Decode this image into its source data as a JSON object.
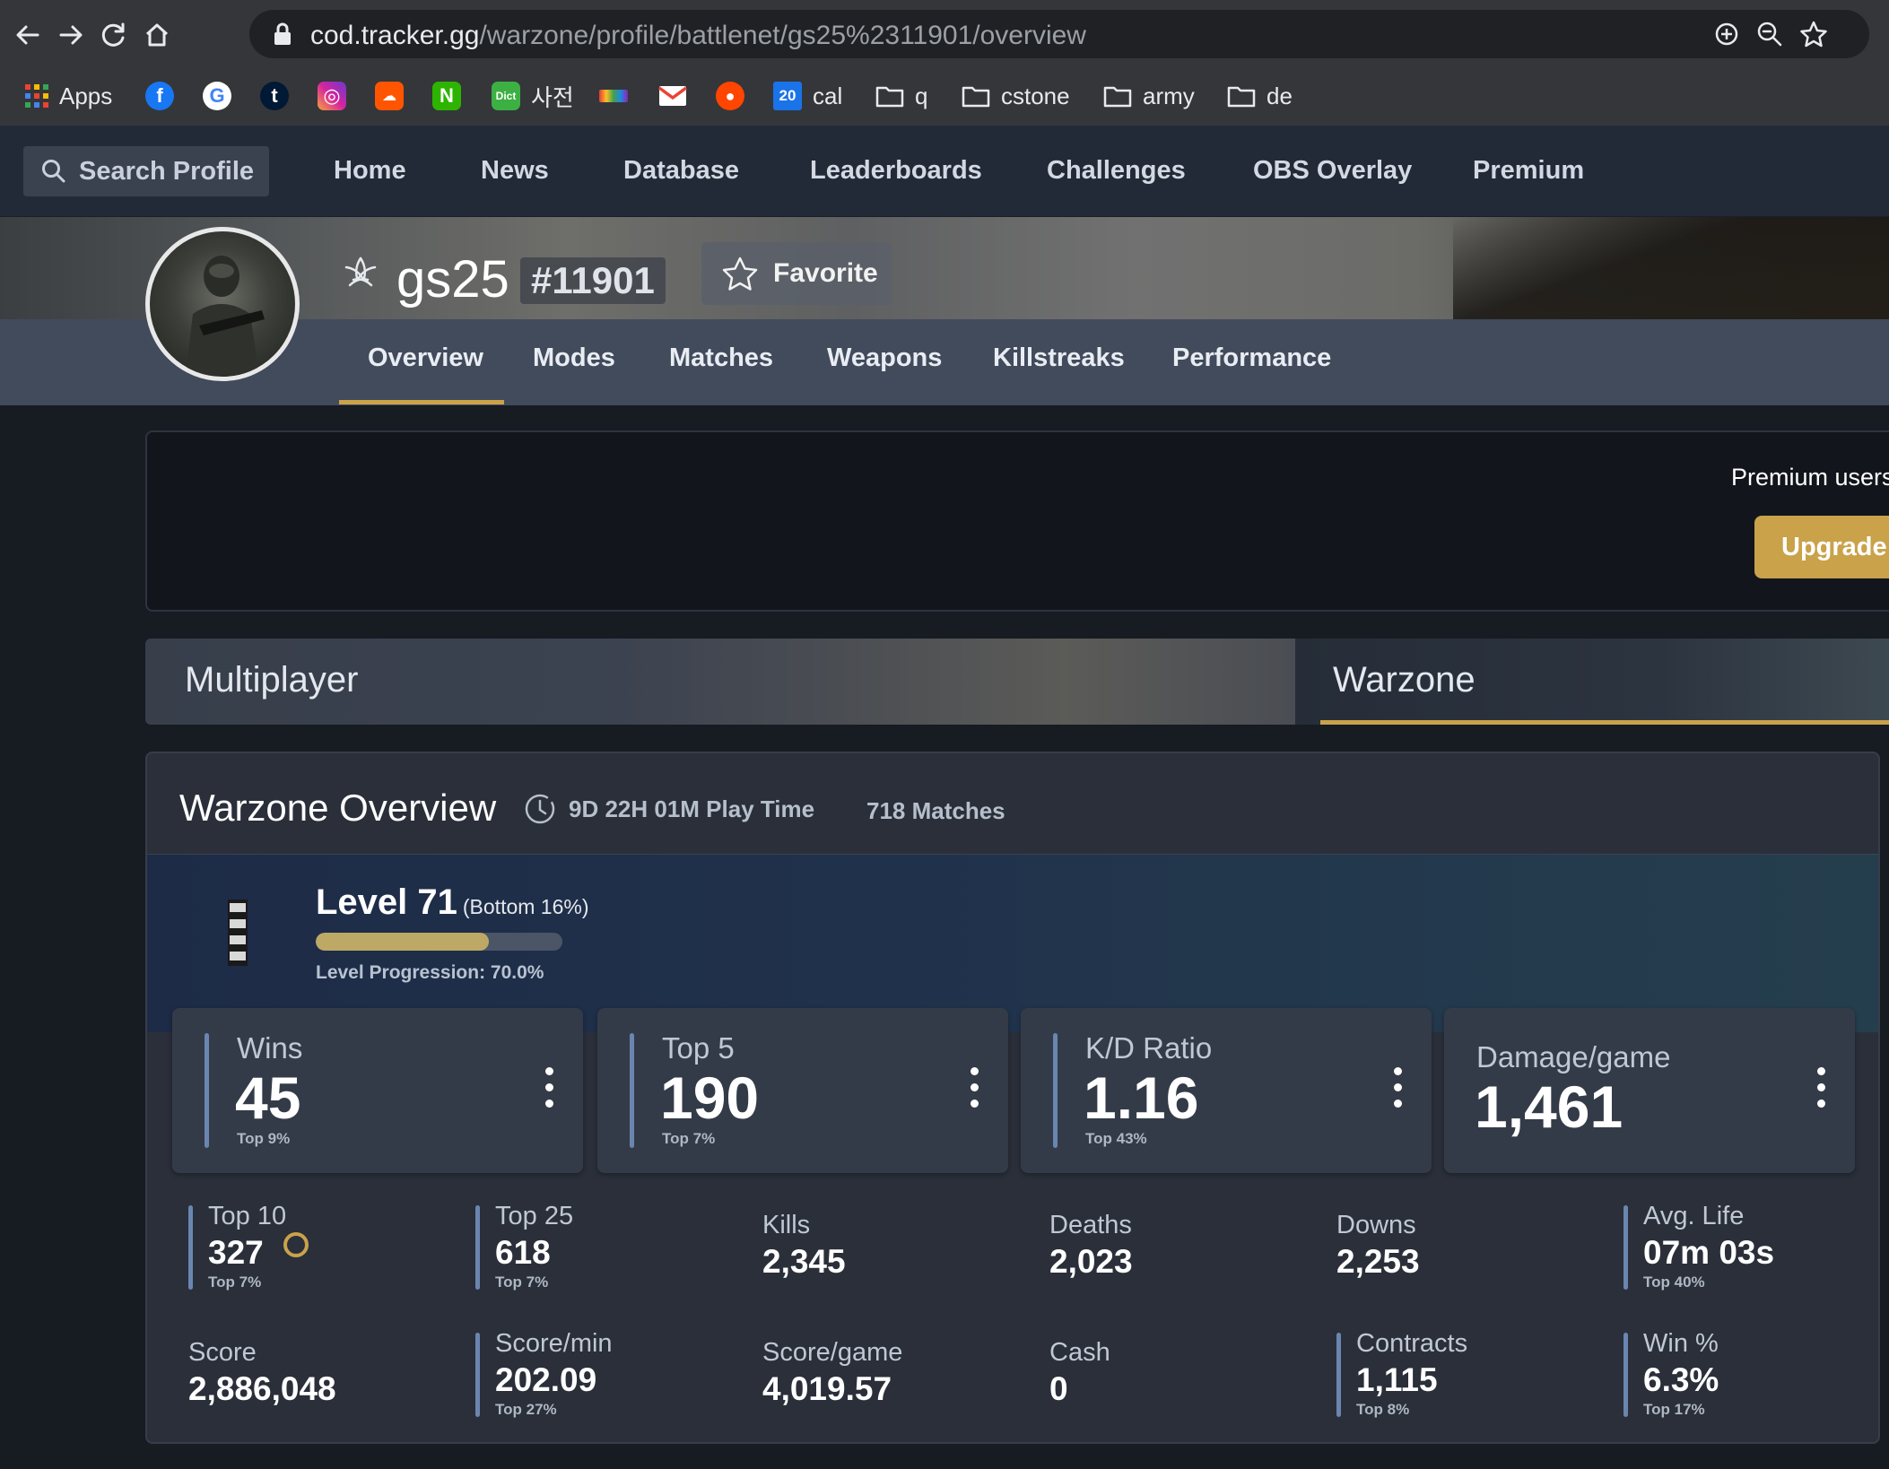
{
  "browser": {
    "url_host": "cod.tracker.gg",
    "url_path": "/warzone/profile/battlenet/gs25%2311901/overview",
    "bookmarks": [
      {
        "label": "Apps",
        "icon": "apps-grid-icon"
      },
      {
        "label": "",
        "icon": "facebook-icon"
      },
      {
        "label": "",
        "icon": "google-icon"
      },
      {
        "label": "",
        "icon": "tumblr-icon"
      },
      {
        "label": "",
        "icon": "instagram-icon"
      },
      {
        "label": "",
        "icon": "soundcloud-icon"
      },
      {
        "label": "",
        "icon": "naver-icon"
      },
      {
        "label": "사전",
        "icon": "dict-icon"
      },
      {
        "label": "",
        "icon": "colorbar-icon"
      },
      {
        "label": "",
        "icon": "gmail-icon"
      },
      {
        "label": "",
        "icon": "reddit-icon"
      },
      {
        "label": "cal",
        "icon": "calendar-icon",
        "icon_text": "20"
      },
      {
        "label": "q",
        "icon": "folder-icon"
      },
      {
        "label": "cstone",
        "icon": "folder-icon"
      },
      {
        "label": "army",
        "icon": "folder-icon"
      },
      {
        "label": "de",
        "icon": "folder-icon"
      }
    ]
  },
  "site_nav": {
    "search_label": "Search Profile",
    "links": [
      "Home",
      "News",
      "Database",
      "Leaderboards",
      "Challenges",
      "OBS Overlay",
      "Premium"
    ]
  },
  "profile": {
    "name": "gs25",
    "tag": "#11901",
    "favorite_label": "Favorite",
    "tabs": [
      "Overview",
      "Modes",
      "Matches",
      "Weapons",
      "Killstreaks",
      "Performance"
    ],
    "active_tab": "Overview"
  },
  "premium": {
    "text": "Premium users",
    "button_label": "Upgrade t"
  },
  "modes": {
    "items": [
      "Multiplayer",
      "Warzone"
    ],
    "active": "Warzone"
  },
  "overview": {
    "title": "Warzone Overview",
    "play_time": "9D 22H 01M Play Time",
    "matches": "718 Matches",
    "level": {
      "label": "Level 71",
      "rank_note": "(Bottom 16%)",
      "progress_text": "Level Progression: 70.0%",
      "progress": 0.7
    },
    "big_stats": [
      {
        "label": "Wins",
        "value": "45",
        "rank": "Top 9%"
      },
      {
        "label": "Top 5",
        "value": "190",
        "rank": "Top 7%"
      },
      {
        "label": "K/D Ratio",
        "value": "1.16",
        "rank": "Top 43%"
      },
      {
        "label": "Damage/game",
        "value": "1,461",
        "rank": ""
      }
    ],
    "row1": [
      {
        "label": "Top 10",
        "value": "327",
        "rank": "Top 7%"
      },
      {
        "label": "Top 25",
        "value": "618",
        "rank": "Top 7%"
      },
      {
        "label": "Kills",
        "value": "2,345",
        "rank": ""
      },
      {
        "label": "Deaths",
        "value": "2,023",
        "rank": ""
      },
      {
        "label": "Downs",
        "value": "2,253",
        "rank": ""
      },
      {
        "label": "Avg. Life",
        "value": "07m 03s",
        "rank": "Top 40%"
      }
    ],
    "row2": [
      {
        "label": "Score",
        "value": "2,886,048",
        "rank": ""
      },
      {
        "label": "Score/min",
        "value": "202.09",
        "rank": "Top 27%"
      },
      {
        "label": "Score/game",
        "value": "4,019.57",
        "rank": ""
      },
      {
        "label": "Cash",
        "value": "0",
        "rank": ""
      },
      {
        "label": "Contracts",
        "value": "1,115",
        "rank": "Top 8%"
      },
      {
        "label": "Win %",
        "value": "6.3%",
        "rank": "Top 17%"
      }
    ]
  },
  "colors": {
    "accent_gold": "#c9a24a",
    "stat_bar_blue": "#6a86b0",
    "nav_bg": "#232a37"
  }
}
